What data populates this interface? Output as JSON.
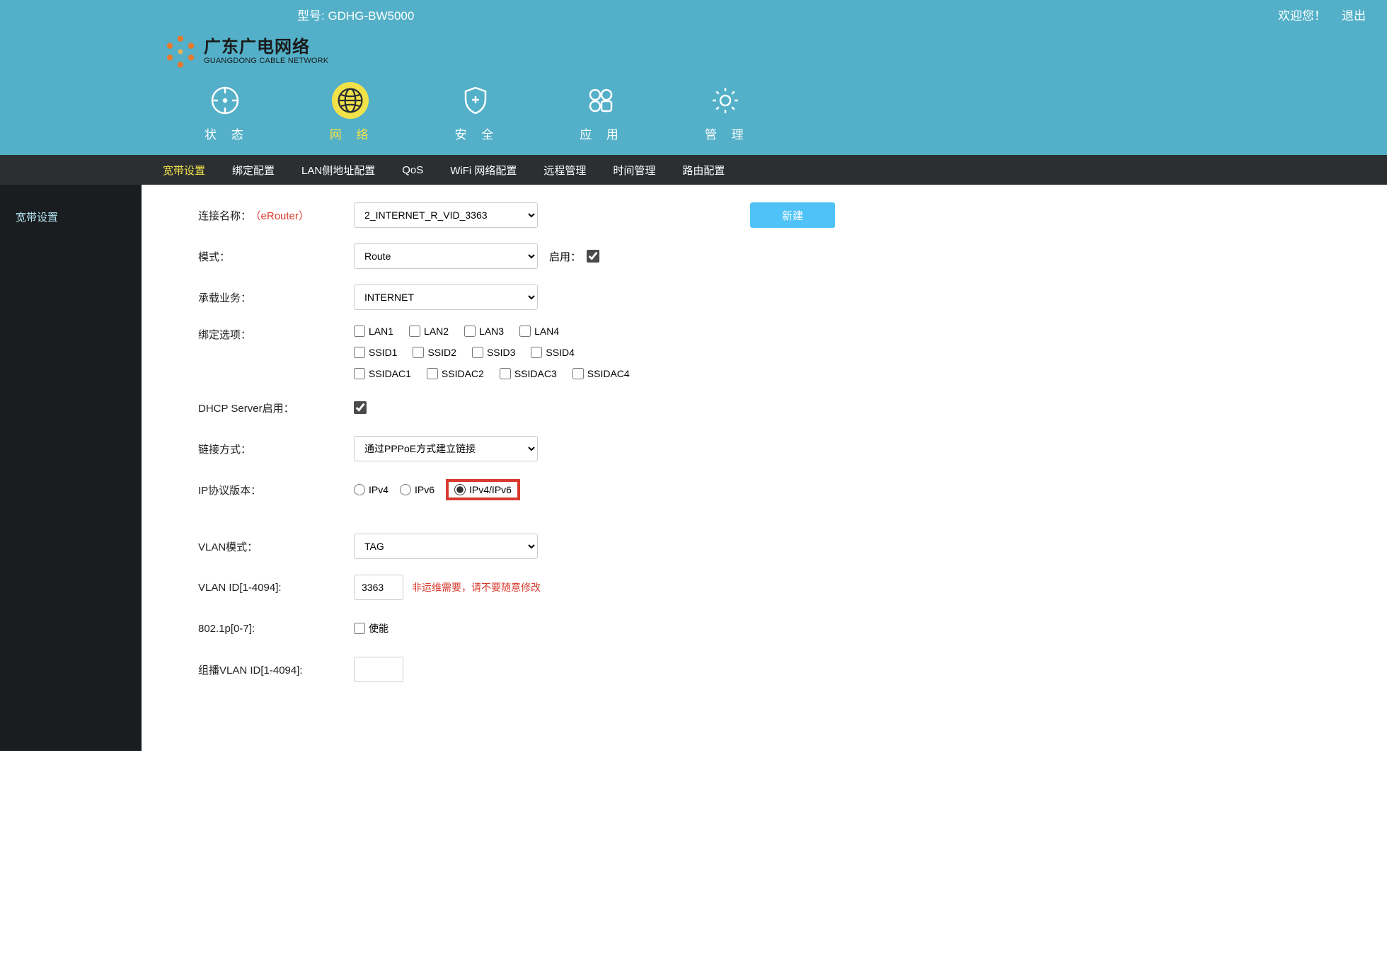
{
  "header": {
    "model_prefix": "型号: ",
    "model": "GDHG-BW5000",
    "welcome": "欢迎您！",
    "logout": "退出"
  },
  "logo": {
    "cn": "广东广电网络",
    "en": "GUANGDONG CABLE NETWORK"
  },
  "nav": [
    {
      "label": "状 态",
      "key": "status",
      "active": false
    },
    {
      "label": "网 络",
      "key": "network",
      "active": true
    },
    {
      "label": "安 全",
      "key": "security",
      "active": false
    },
    {
      "label": "应 用",
      "key": "apps",
      "active": false
    },
    {
      "label": "管 理",
      "key": "admin",
      "active": false
    }
  ],
  "subnav": [
    {
      "label": "宽带设置",
      "active": true
    },
    {
      "label": "绑定配置",
      "active": false
    },
    {
      "label": "LAN侧地址配置",
      "active": false
    },
    {
      "label": "QoS",
      "active": false
    },
    {
      "label": "WiFi 网络配置",
      "active": false
    },
    {
      "label": "远程管理",
      "active": false
    },
    {
      "label": "时间管理",
      "active": false
    },
    {
      "label": "路由配置",
      "active": false
    }
  ],
  "sidebar": {
    "item0": "宽带设置"
  },
  "form": {
    "conn_name_label": "连接名称：",
    "conn_name_suffix": "（eRouter）",
    "conn_name_value": "2_INTERNET_R_VID_3363",
    "new_btn": "新建",
    "mode_label": "模式：",
    "mode_value": "Route",
    "enable_label": "启用：",
    "enable_checked": true,
    "service_label": "承载业务：",
    "service_value": "INTERNET",
    "bind_label": "绑定选项：",
    "bind_row1": [
      "LAN1",
      "LAN2",
      "LAN3",
      "LAN4"
    ],
    "bind_row2": [
      "SSID1",
      "SSID2",
      "SSID3",
      "SSID4"
    ],
    "bind_row3": [
      "SSIDAC1",
      "SSIDAC2",
      "SSIDAC3",
      "SSIDAC4"
    ],
    "dhcp_label": "DHCP Server启用：",
    "dhcp_checked": true,
    "link_label": "链接方式：",
    "link_value": "通过PPPoE方式建立链接",
    "ip_label": "IP协议版本：",
    "ip_opt1": "IPv4",
    "ip_opt2": "IPv6",
    "ip_opt3": "IPv4/IPv6",
    "ip_selected": "IPv4/IPv6",
    "vlan_mode_label": "VLAN模式：",
    "vlan_mode_value": "TAG",
    "vlan_id_label": "VLAN ID[1-4094]:",
    "vlan_id_value": "3363",
    "vlan_warn": "非运维需要，请不要随意修改",
    "p8021_label": "802.1p[0-7]:",
    "p8021_enable": "使能",
    "mcast_label": "组播VLAN ID[1-4094]:"
  }
}
